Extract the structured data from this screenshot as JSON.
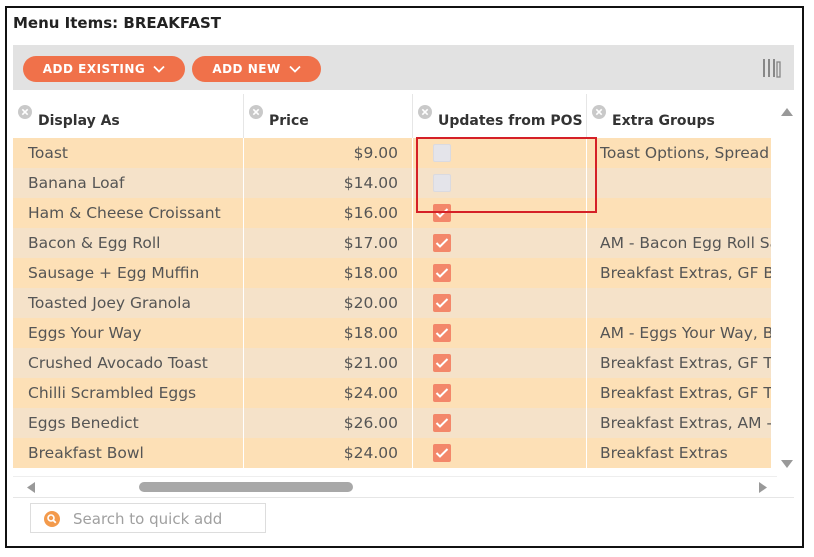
{
  "panel": {
    "title": "Menu Items: BREAKFAST"
  },
  "toolbar": {
    "add_existing_label": "ADD EXISTING",
    "add_new_label": "ADD NEW",
    "columns_icon": "column-settings-icon",
    "accent_color": "#f0714a"
  },
  "grid": {
    "columns": [
      "Display As",
      "Price",
      "Updates from POS",
      "Extra Groups"
    ],
    "rows": [
      {
        "name": "Toast",
        "price": "$9.00",
        "updates_from_pos": false,
        "extra_groups": "Toast Options, Spread Options"
      },
      {
        "name": "Banana Loaf",
        "price": "$14.00",
        "updates_from_pos": false,
        "extra_groups": ""
      },
      {
        "name": "Ham & Cheese Croissant",
        "price": "$16.00",
        "updates_from_pos": true,
        "extra_groups": ""
      },
      {
        "name": "Bacon & Egg Roll",
        "price": "$17.00",
        "updates_from_pos": true,
        "extra_groups": "AM - Bacon Egg Roll Sauce"
      },
      {
        "name": "Sausage + Egg Muffin",
        "price": "$18.00",
        "updates_from_pos": true,
        "extra_groups": "Breakfast Extras, GF Bun"
      },
      {
        "name": "Toasted Joey Granola",
        "price": "$20.00",
        "updates_from_pos": true,
        "extra_groups": ""
      },
      {
        "name": "Eggs Your Way",
        "price": "$18.00",
        "updates_from_pos": true,
        "extra_groups": "AM - Eggs Your Way, Bread"
      },
      {
        "name": "Crushed Avocado Toast",
        "price": "$21.00",
        "updates_from_pos": true,
        "extra_groups": "Breakfast Extras, GF Toast"
      },
      {
        "name": "Chilli Scrambled Eggs",
        "price": "$24.00",
        "updates_from_pos": true,
        "extra_groups": "Breakfast Extras, GF Toast"
      },
      {
        "name": "Eggs Benedict",
        "price": "$26.00",
        "updates_from_pos": true,
        "extra_groups": "Breakfast Extras, AM - Eggs"
      },
      {
        "name": "Breakfast Bowl",
        "price": "$24.00",
        "updates_from_pos": true,
        "extra_groups": "Breakfast Extras"
      }
    ]
  },
  "search": {
    "placeholder": "Search to quick add"
  }
}
